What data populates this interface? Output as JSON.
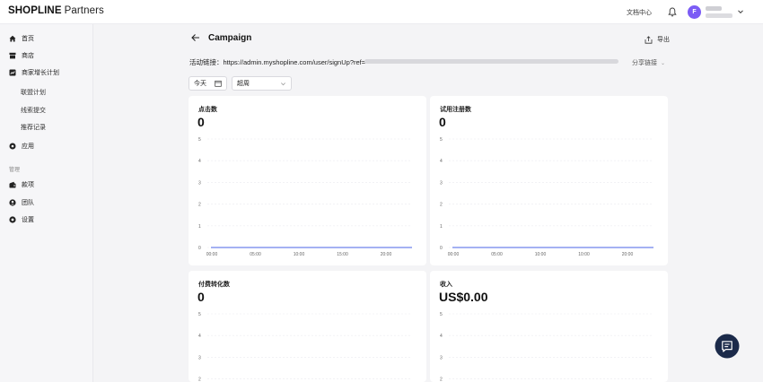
{
  "topbar": {
    "logo_brand": "SHOPLINE",
    "logo_sub": "Partners",
    "doc_center": "文档中心",
    "avatar_initial": "F"
  },
  "sidebar": {
    "items": [
      {
        "label": "首页",
        "icon": "home-icon"
      },
      {
        "label": "商店",
        "icon": "store-icon"
      },
      {
        "label": "商家增长计划",
        "icon": "growth-icon"
      }
    ],
    "sub_items": [
      "联盟计划",
      "线索提交",
      "推荐记录"
    ],
    "apps": {
      "label": "应用",
      "icon": "apps-icon"
    },
    "section_label": "管理",
    "manage_items": [
      {
        "label": "款项",
        "icon": "wallet-icon"
      },
      {
        "label": "团队",
        "icon": "team-icon"
      },
      {
        "label": "设置",
        "icon": "settings-icon"
      }
    ]
  },
  "header": {
    "title": "Campaign",
    "export_label": "导出",
    "link_label": "活动链接：https://admin.myshopline.com/user/signUp?ref=",
    "share_label": "分享链接"
  },
  "filters": {
    "date_label": "今天",
    "granularity": "超周"
  },
  "cards": [
    {
      "title": "点击数",
      "value": "0"
    },
    {
      "title": "试用注册数",
      "value": "0"
    },
    {
      "title": "付费转化数",
      "value": "0"
    },
    {
      "title": "收入",
      "value": "US$0.00"
    }
  ],
  "chart_data": [
    {
      "type": "line",
      "title": "点击数",
      "x": [
        "00:00",
        "05:00",
        "10:00",
        "15:00",
        "20:00"
      ],
      "y_ticks": [
        0,
        1,
        2,
        3,
        4,
        5
      ],
      "ylim": [
        0,
        5
      ],
      "series": [
        {
          "values": [
            0,
            0,
            0,
            0,
            0
          ]
        }
      ],
      "grid": true
    },
    {
      "type": "line",
      "title": "试用注册数",
      "x": [
        "00:00",
        "05:00",
        "10:00",
        "10:00",
        "20:00"
      ],
      "y_ticks": [
        0,
        1,
        2,
        3,
        4,
        5
      ],
      "ylim": [
        0,
        5
      ],
      "series": [
        {
          "values": [
            0,
            0,
            0,
            0,
            0
          ]
        }
      ],
      "grid": true
    },
    {
      "type": "line",
      "title": "付费转化数",
      "y_ticks": [
        2,
        3,
        4,
        5
      ],
      "ylim": [
        0,
        5
      ],
      "grid": true
    },
    {
      "type": "line",
      "title": "收入",
      "y_ticks": [
        2,
        3,
        4,
        5
      ],
      "ylim": [
        0,
        5
      ],
      "grid": true
    }
  ],
  "colors": {
    "accent": "#7b5cf5",
    "line": "#4a63e7",
    "fab": "#1b2a4a"
  }
}
